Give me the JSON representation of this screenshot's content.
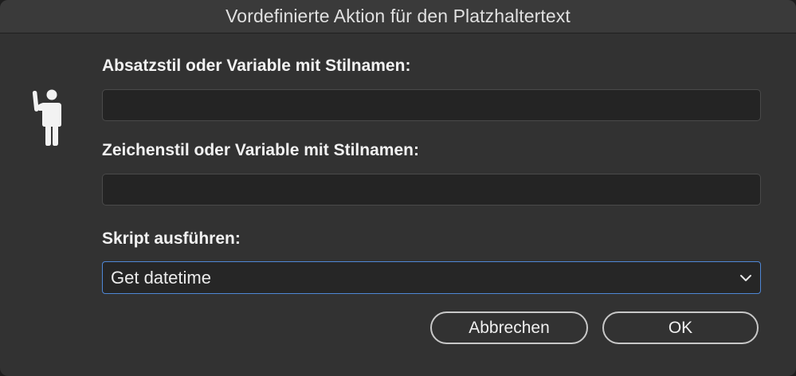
{
  "window": {
    "title": "Vordefinierte Aktion für den Platzhaltertext"
  },
  "icons": {
    "dialog_icon": "person-raising-hand-icon",
    "dropdown_icon": "chevron-down-icon"
  },
  "fields": {
    "paragraph_style": {
      "label": "Absatzstil oder Variable mit Stilnamen:",
      "value": ""
    },
    "character_style": {
      "label": "Zeichenstil oder Variable mit Stilnamen:",
      "value": ""
    },
    "script": {
      "label": "Skript ausführen:",
      "selected": "Get datetime"
    }
  },
  "buttons": {
    "cancel": "Abbrechen",
    "ok": "OK"
  },
  "colors": {
    "focus_ring": "#4f87d6",
    "background": "#323232"
  }
}
